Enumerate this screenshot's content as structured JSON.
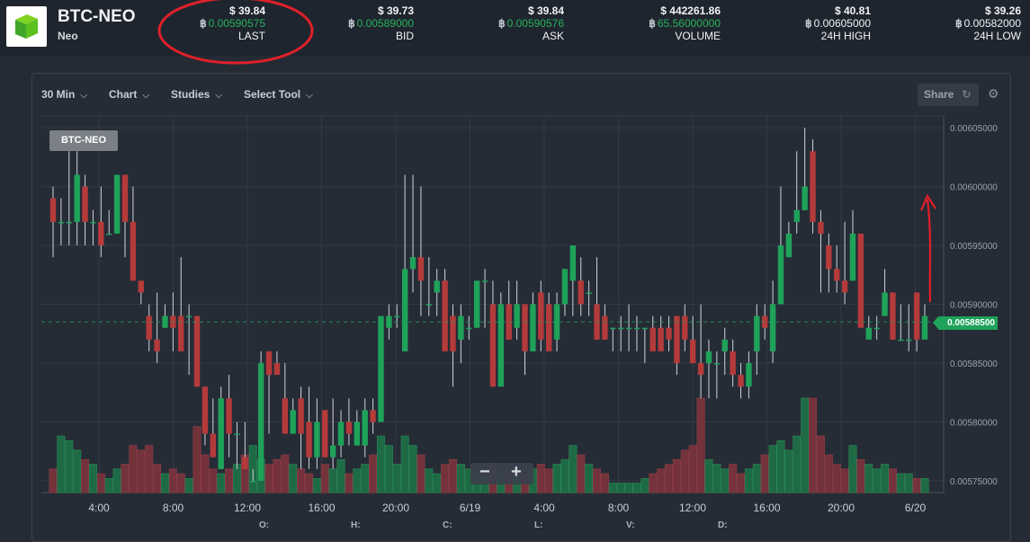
{
  "header": {
    "pair": "BTC-NEO",
    "coin": "Neo",
    "btc_symbol": "฿",
    "stats": [
      {
        "id": "last",
        "usd": "$ 39.84",
        "btc": "0.00590575",
        "label": "LAST"
      },
      {
        "id": "bid",
        "usd": "$ 39.73",
        "btc": "0.00589000",
        "label": "BID"
      },
      {
        "id": "ask",
        "usd": "$ 39.84",
        "btc": "0.00590576",
        "label": "ASK"
      },
      {
        "id": "volume",
        "usd": "$ 442261.86",
        "btc": "65.56000000",
        "label": "VOLUME"
      },
      {
        "id": "high",
        "usd": "$ 40.81",
        "btc": "0.00605000",
        "label": "24H HIGH"
      },
      {
        "id": "low",
        "usd": "$ 39.26",
        "btc": "0.00582000",
        "label": "24H LOW"
      }
    ]
  },
  "toolbar": {
    "interval": "30 Min",
    "chart": "Chart",
    "studies": "Studies",
    "select_tool": "Select Tool",
    "share": "Share"
  },
  "chart_label": "BTC-NEO",
  "price_tag": "0.00588500",
  "ohlc_labels": [
    "O:",
    "H:",
    "C:",
    "L:",
    "V:",
    "D:"
  ],
  "zoom": {
    "minus": "−",
    "plus": "+"
  },
  "colors": {
    "up": "#1fa25a",
    "down": "#b53a3a",
    "up_vol": "#1e6a44",
    "down_vol": "#74323a",
    "annotation": "#e0202a"
  },
  "chart_data": {
    "type": "candlestick",
    "ylim": [
      0.00574,
      0.00606
    ],
    "y_ticks": [
      "0.00575000",
      "0.00580000",
      "0.00585000",
      "0.00590000",
      "0.00595000",
      "0.00600000",
      "0.00605000"
    ],
    "x_ticks": [
      "4:00",
      "8:00",
      "12:00",
      "16:00",
      "20:00",
      "6/19",
      "4:00",
      "8:00",
      "12:00",
      "16:00",
      "20:00",
      "6/20"
    ],
    "last_price": 0.005885,
    "candles": [
      [
        0.00599,
        0.00597,
        0.006,
        0.00594,
        0.25
      ],
      [
        0.00597,
        0.00597,
        0.00599,
        0.00595,
        0.6
      ],
      [
        0.00597,
        0.00597,
        0.00603,
        0.00595,
        0.55
      ],
      [
        0.00597,
        0.00601,
        0.00603,
        0.00595,
        0.45
      ],
      [
        0.006,
        0.00597,
        0.00601,
        0.00595,
        0.35
      ],
      [
        0.00597,
        0.00597,
        0.00598,
        0.00595,
        0.3
      ],
      [
        0.00597,
        0.00595,
        0.006,
        0.00594,
        0.2
      ],
      [
        0.00596,
        0.00596,
        0.00598,
        0.00596,
        0.15
      ],
      [
        0.00596,
        0.00601,
        0.00601,
        0.00596,
        0.25
      ],
      [
        0.00601,
        0.00597,
        0.00601,
        0.00594,
        0.3
      ],
      [
        0.00597,
        0.00592,
        0.006,
        0.00592,
        0.5
      ],
      [
        0.00592,
        0.00591,
        0.00592,
        0.0059,
        0.45
      ],
      [
        0.00589,
        0.00587,
        0.0059,
        0.00586,
        0.5
      ],
      [
        0.00587,
        0.00586,
        0.00591,
        0.00585,
        0.3
      ],
      [
        0.00588,
        0.00589,
        0.0059,
        0.00588,
        0.2
      ],
      [
        0.00589,
        0.00588,
        0.00591,
        0.00586,
        0.25
      ],
      [
        0.00589,
        0.00586,
        0.00594,
        0.00586,
        0.2
      ],
      [
        0.00589,
        0.00589,
        0.0059,
        0.00584,
        0.15
      ],
      [
        0.00589,
        0.00583,
        0.00589,
        0.00583,
        0.7
      ],
      [
        0.00583,
        0.00579,
        0.00583,
        0.00578,
        0.4
      ],
      [
        0.00579,
        0.00577,
        0.00582,
        0.00577,
        0.25
      ],
      [
        0.00576,
        0.00582,
        0.00583,
        0.00576,
        0.2
      ],
      [
        0.00582,
        0.00579,
        0.00584,
        0.00577,
        0.25
      ],
      [
        0.00579,
        0.00579,
        0.0058,
        0.00576,
        0.3
      ],
      [
        0.00577,
        0.00576,
        0.0058,
        0.00576,
        0.4
      ],
      [
        0.00575,
        0.00575,
        0.00576,
        0.00575,
        0.5
      ],
      [
        0.00575,
        0.00585,
        0.00586,
        0.00575,
        0.35
      ],
      [
        0.00586,
        0.00584,
        0.00586,
        0.00579,
        0.3
      ],
      [
        0.00585,
        0.00584,
        0.00586,
        0.00584,
        0.35
      ],
      [
        0.00582,
        0.00579,
        0.00585,
        0.00579,
        0.4
      ],
      [
        0.00579,
        0.00581,
        0.00582,
        0.00579,
        0.3
      ],
      [
        0.00582,
        0.00579,
        0.00583,
        0.00576,
        0.25
      ],
      [
        0.0058,
        0.00577,
        0.00583,
        0.00576,
        0.2
      ],
      [
        0.00577,
        0.0058,
        0.00582,
        0.00576,
        0.15
      ],
      [
        0.00581,
        0.00577,
        0.00581,
        0.00577,
        0.3
      ],
      [
        0.00577,
        0.00578,
        0.00582,
        0.00576,
        0.25
      ],
      [
        0.00578,
        0.0058,
        0.00581,
        0.00577,
        0.35
      ],
      [
        0.0058,
        0.00579,
        0.00582,
        0.00578,
        0.2
      ],
      [
        0.00578,
        0.0058,
        0.00581,
        0.00578,
        0.25
      ],
      [
        0.00578,
        0.00581,
        0.00582,
        0.00577,
        0.3
      ],
      [
        0.00581,
        0.0058,
        0.00582,
        0.00579,
        0.4
      ],
      [
        0.0058,
        0.00589,
        0.00589,
        0.0058,
        0.6
      ],
      [
        0.00588,
        0.00589,
        0.0059,
        0.00587,
        0.5
      ],
      [
        0.00589,
        0.00589,
        0.0059,
        0.00588,
        0.3
      ],
      [
        0.00586,
        0.00593,
        0.00601,
        0.00586,
        0.6
      ],
      [
        0.00593,
        0.00594,
        0.00601,
        0.00591,
        0.5
      ],
      [
        0.00594,
        0.00592,
        0.006,
        0.00589,
        0.4
      ],
      [
        0.0059,
        0.0059,
        0.00594,
        0.00589,
        0.25
      ],
      [
        0.00591,
        0.00592,
        0.00593,
        0.00589,
        0.2
      ],
      [
        0.00592,
        0.00586,
        0.00593,
        0.00586,
        0.3
      ],
      [
        0.00589,
        0.00586,
        0.0059,
        0.00583,
        0.35
      ],
      [
        0.00587,
        0.00589,
        0.0059,
        0.00585,
        0.3
      ],
      [
        0.00588,
        0.00588,
        0.00589,
        0.00587,
        0.25
      ],
      [
        0.00588,
        0.00592,
        0.00592,
        0.00588,
        0.2
      ],
      [
        0.00592,
        0.00592,
        0.00593,
        0.00588,
        0.15
      ],
      [
        0.0059,
        0.00583,
        0.00592,
        0.00583,
        0.3
      ],
      [
        0.00583,
        0.0059,
        0.00591,
        0.00583,
        0.2
      ],
      [
        0.0059,
        0.00587,
        0.00592,
        0.00587,
        0.2
      ],
      [
        0.00588,
        0.0059,
        0.00592,
        0.00587,
        0.15
      ],
      [
        0.0059,
        0.00586,
        0.0059,
        0.00584,
        0.2
      ],
      [
        0.00586,
        0.0059,
        0.00591,
        0.00586,
        0.25
      ],
      [
        0.00591,
        0.00587,
        0.00592,
        0.00586,
        0.3
      ],
      [
        0.0059,
        0.00586,
        0.00591,
        0.00586,
        0.25
      ],
      [
        0.00587,
        0.0059,
        0.00591,
        0.00586,
        0.3
      ],
      [
        0.0059,
        0.00593,
        0.00593,
        0.00589,
        0.35
      ],
      [
        0.00592,
        0.00595,
        0.00595,
        0.00589,
        0.5
      ],
      [
        0.00592,
        0.0059,
        0.00594,
        0.00589,
        0.4
      ],
      [
        0.00591,
        0.00591,
        0.00592,
        0.00589,
        0.3
      ],
      [
        0.0059,
        0.00587,
        0.00594,
        0.00587,
        0.25
      ],
      [
        0.00589,
        0.00587,
        0.0059,
        0.00587,
        0.2
      ],
      [
        0.00588,
        0.00588,
        0.00588,
        0.00586,
        0.1
      ],
      [
        0.00588,
        0.00588,
        0.00589,
        0.00586,
        0.1
      ],
      [
        0.00588,
        0.00588,
        0.0059,
        0.00586,
        0.1
      ],
      [
        0.00588,
        0.00588,
        0.00589,
        0.00586,
        0.1
      ],
      [
        0.00588,
        0.00588,
        0.00588,
        0.00585,
        0.15
      ],
      [
        0.00588,
        0.00586,
        0.00589,
        0.00586,
        0.2
      ],
      [
        0.00588,
        0.00586,
        0.00589,
        0.00586,
        0.25
      ],
      [
        0.00588,
        0.00587,
        0.00589,
        0.00586,
        0.3
      ],
      [
        0.00589,
        0.00585,
        0.00589,
        0.00584,
        0.35
      ],
      [
        0.00589,
        0.00587,
        0.0059,
        0.00586,
        0.45
      ],
      [
        0.00587,
        0.00585,
        0.00589,
        0.00585,
        0.5
      ],
      [
        0.00585,
        0.00584,
        0.0059,
        0.00582,
        1.0
      ],
      [
        0.00585,
        0.00586,
        0.00587,
        0.00582,
        0.35
      ],
      [
        0.00585,
        0.00585,
        0.00586,
        0.00582,
        0.3
      ],
      [
        0.00586,
        0.00587,
        0.00588,
        0.00584,
        0.25
      ],
      [
        0.00586,
        0.00584,
        0.00587,
        0.00583,
        0.3
      ],
      [
        0.00584,
        0.00583,
        0.00585,
        0.00582,
        0.2
      ],
      [
        0.00583,
        0.00585,
        0.00586,
        0.00582,
        0.25
      ],
      [
        0.00586,
        0.00589,
        0.0059,
        0.00584,
        0.3
      ],
      [
        0.00589,
        0.00588,
        0.0059,
        0.00587,
        0.4
      ],
      [
        0.00586,
        0.0059,
        0.00592,
        0.00585,
        0.5
      ],
      [
        0.0059,
        0.00595,
        0.006,
        0.0059,
        0.55
      ],
      [
        0.00594,
        0.00596,
        0.00597,
        0.00594,
        0.45
      ],
      [
        0.00597,
        0.00598,
        0.00603,
        0.00596,
        0.6
      ],
      [
        0.00598,
        0.006,
        0.00605,
        0.00598,
        1.0
      ],
      [
        0.00603,
        0.00597,
        0.00604,
        0.00596,
        1.0
      ],
      [
        0.00597,
        0.00596,
        0.00598,
        0.00591,
        0.6
      ],
      [
        0.00595,
        0.00593,
        0.00596,
        0.00591,
        0.4
      ],
      [
        0.00593,
        0.00592,
        0.00595,
        0.00591,
        0.3
      ],
      [
        0.00592,
        0.00591,
        0.00597,
        0.0059,
        0.25
      ],
      [
        0.00592,
        0.00596,
        0.00598,
        0.00592,
        0.5
      ],
      [
        0.00596,
        0.00588,
        0.00596,
        0.00588,
        0.35
      ],
      [
        0.00587,
        0.00588,
        0.00589,
        0.00587,
        0.3
      ],
      [
        0.00588,
        0.00588,
        0.00589,
        0.00587,
        0.25
      ],
      [
        0.00589,
        0.00591,
        0.00593,
        0.00589,
        0.3
      ],
      [
        0.00591,
        0.00587,
        0.00591,
        0.00587,
        0.25
      ],
      [
        0.00587,
        0.00587,
        0.0059,
        0.00587,
        0.2
      ],
      [
        0.00587,
        0.00587,
        0.0059,
        0.00586,
        0.2
      ],
      [
        0.00591,
        0.00587,
        0.00591,
        0.00586,
        0.15
      ],
      [
        0.00587,
        0.00589,
        0.0059,
        0.00587,
        0.15
      ]
    ]
  }
}
